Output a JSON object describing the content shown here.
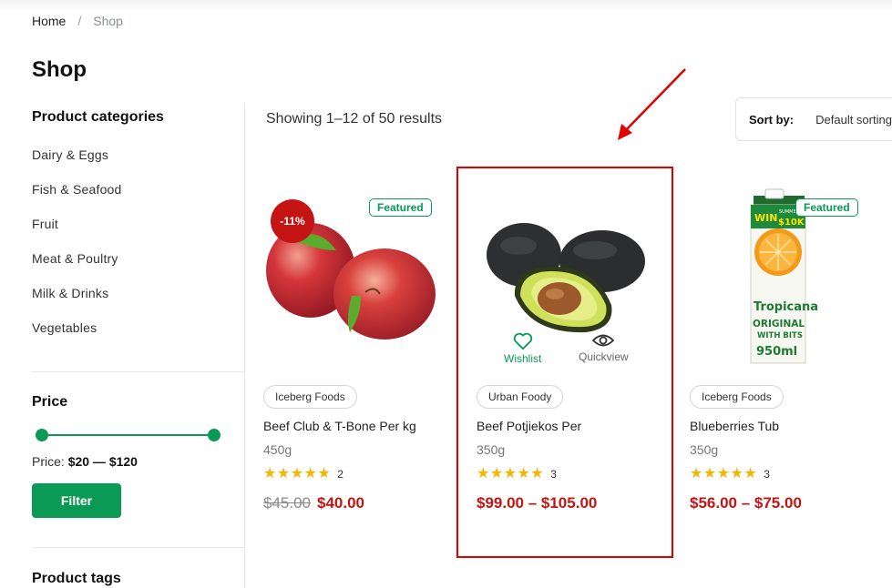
{
  "breadcrumb": {
    "home": "Home",
    "separator": "/",
    "current": "Shop"
  },
  "page_title": "Shop",
  "sidebar": {
    "categories_heading": "Product categories",
    "categories": [
      "Dairy & Eggs",
      "Fish & Seafood",
      "Fruit",
      "Meat & Poultry",
      "Milk & Drinks",
      "Vegetables"
    ],
    "price_heading": "Price",
    "price_label": "Price:",
    "price_range": "$20 — $120",
    "filter_button": "Filter",
    "tags_heading": "Product tags"
  },
  "toolbar": {
    "result_count": "Showing 1–12 of 50 results",
    "sort_label": "Sort by:",
    "sort_value": "Default sorting"
  },
  "products": [
    {
      "badge_featured": "Featured",
      "badge_sale": "-11%",
      "brand": "Iceberg Foods",
      "name": "Beef Club & T-Bone Per kg",
      "weight": "450g",
      "rating_count": "2",
      "price_old": "$45.00",
      "price": "$40.00"
    },
    {
      "brand": "Urban Foody",
      "name": "Beef Potjiekos Per",
      "weight": "350g",
      "rating_count": "3",
      "price": "$99.00 – $105.00",
      "wishlist_label": "Wishlist",
      "quickview_label": "Quickview"
    },
    {
      "badge_featured": "Featured",
      "brand": "Iceberg Foods",
      "name": "Blueberries Tub",
      "weight": "350g",
      "rating_count": "3",
      "price": "$56.00 – $75.00",
      "package_text": {
        "promo": "WIN",
        "promo_sub": "SUMMER OF",
        "promo_amount": "$10K",
        "brand": "Tropicana",
        "line1": "ORIGINAL",
        "line2": "WITH BITS",
        "volume": "950ml"
      }
    }
  ],
  "colors": {
    "accent_green": "#0a9a55",
    "sale_red": "#c41414",
    "highlight_red": "#e00000",
    "star_yellow": "#f6b500"
  }
}
